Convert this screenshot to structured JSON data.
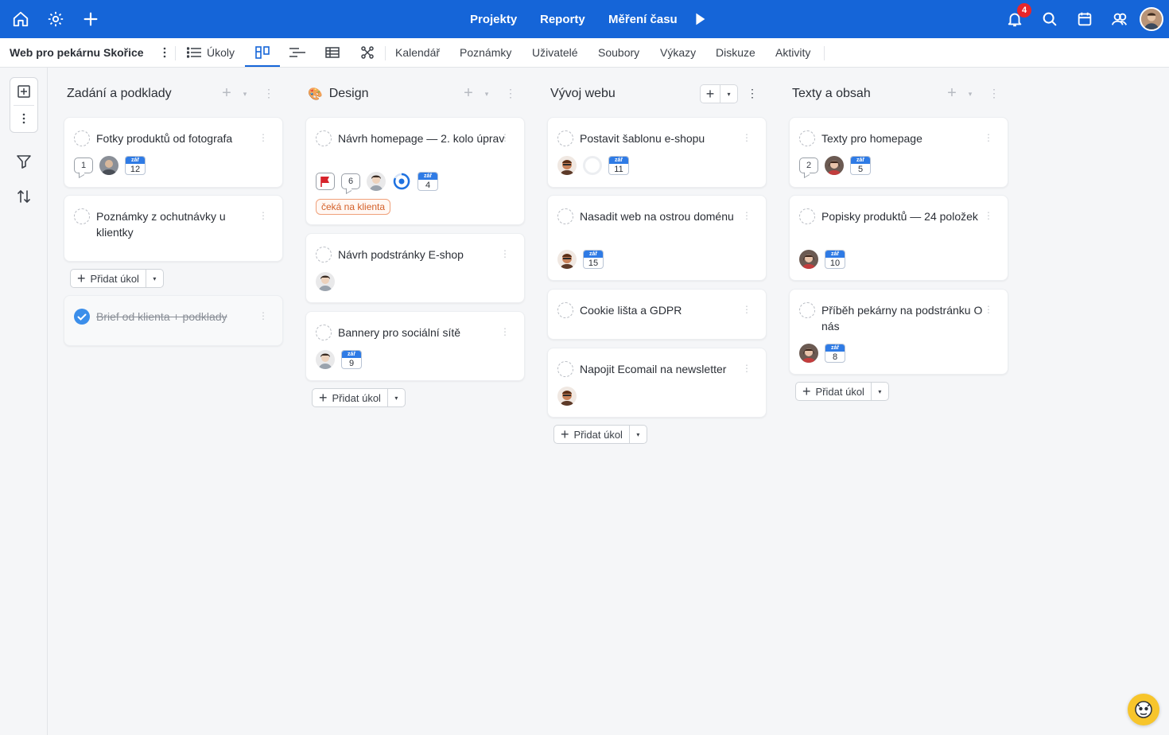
{
  "topbar": {
    "nav": [
      "Projekty",
      "Reporty",
      "Měření času"
    ],
    "notification_count": "4"
  },
  "subbar": {
    "project_title": "Web pro pekárnu Skořice",
    "tasks_label": "Úkoly",
    "tabs": [
      "Kalendář",
      "Poznámky",
      "Uživatelé",
      "Soubory",
      "Výkazy",
      "Diskuze",
      "Aktivity"
    ]
  },
  "add_task_label": "Přidat úkol",
  "columns": [
    {
      "title": "Zadání a podklady",
      "cards": [
        {
          "title": "Fotky produktů od fotografa",
          "comments": "1",
          "date_month": "zář",
          "date_day": "12"
        },
        {
          "title": "Poznámky z ochutnávky u klientky"
        },
        {
          "title": "Brief od klienta + podklady",
          "done": true
        }
      ]
    },
    {
      "title": "Design",
      "emoji": "🎨",
      "cards": [
        {
          "title": "Návrh homepage — 2. kolo úprav",
          "comments": "6",
          "date_month": "zář",
          "date_day": "4",
          "tag": "čeká na klienta"
        },
        {
          "title": "Návrh podstránky E-shop"
        },
        {
          "title": "Bannery pro sociální sítě",
          "date_month": "zář",
          "date_day": "9"
        }
      ]
    },
    {
      "title": "Vývoj webu",
      "cards": [
        {
          "title": "Postavit šablonu e-shopu",
          "date_month": "zář",
          "date_day": "11"
        },
        {
          "title": "Nasadit web na ostrou doménu",
          "date_month": "zář",
          "date_day": "15"
        },
        {
          "title": "Cookie lišta a GDPR"
        },
        {
          "title": "Napojit Ecomail na newsletter"
        }
      ]
    },
    {
      "title": "Texty a obsah",
      "cards": [
        {
          "title": "Texty pro homepage",
          "comments": "2",
          "date_month": "zář",
          "date_day": "5"
        },
        {
          "title": "Popisky produktů — 24 položek",
          "date_month": "zář",
          "date_day": "10"
        },
        {
          "title": "Příběh pekárny na podstránku O nás",
          "date_month": "zář",
          "date_day": "8"
        }
      ]
    }
  ]
}
